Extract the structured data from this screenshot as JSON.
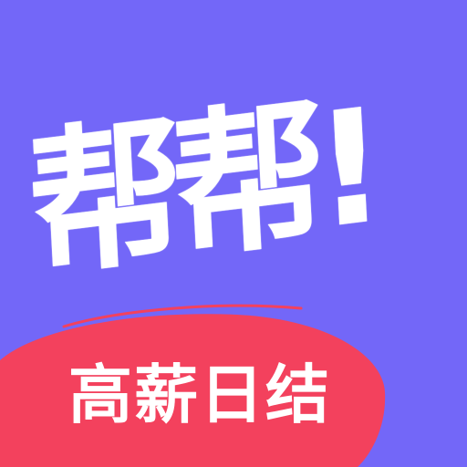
{
  "icon": {
    "brand_text": "帮帮!",
    "slogan": "高薪日结"
  },
  "colors": {
    "background": "#7367F8",
    "ribbon": "#F3415D",
    "text": "#FFFFFF"
  }
}
